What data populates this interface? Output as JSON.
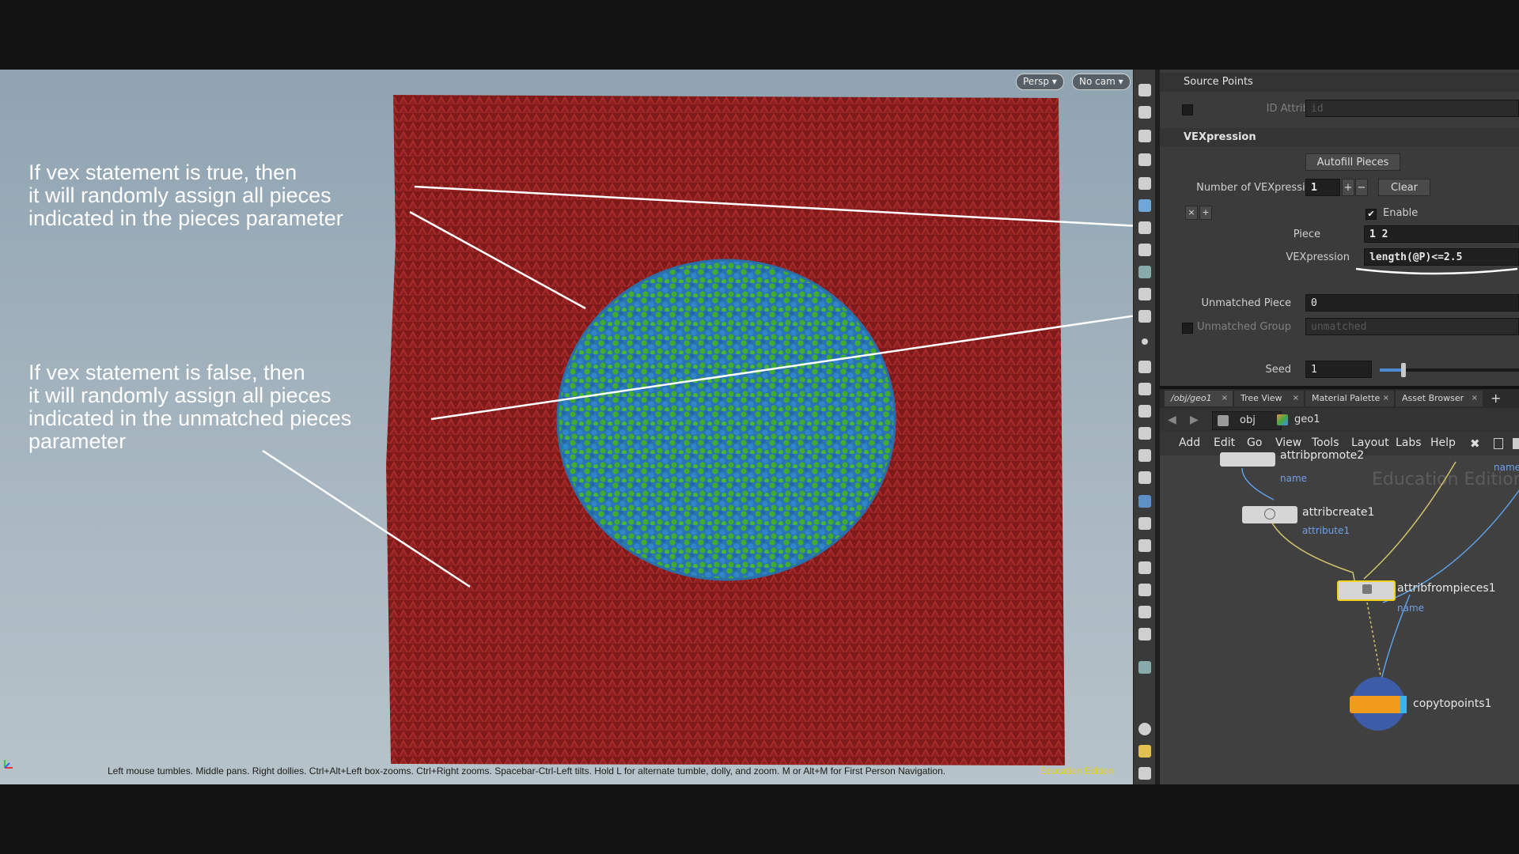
{
  "viewport": {
    "persp_label": "Persp ▾",
    "cam_label": "No cam ▾",
    "annotation_true": [
      "If vex statement is true, then",
      "it will randomly assign all pieces",
      "indicated in the pieces parameter"
    ],
    "annotation_false": [
      "If vex statement is false, then",
      "it will randomly assign all pieces",
      "indicated in the unmatched pieces",
      "parameter"
    ],
    "status_hint": "Left mouse tumbles. Middle pans. Right dollies. Ctrl+Alt+Left box-zooms. Ctrl+Right zooms. Spacebar-Ctrl-Left tilts. Hold L for alternate tumble, dolly, and zoom.     M or Alt+M for First Person Navigation.",
    "edu_label": "Education Edition",
    "colors": {
      "ground": "#8b1f1f",
      "sphere_blue": "#2a78b8",
      "sphere_green": "#3aa82a"
    }
  },
  "params": {
    "source_points_header": "Source Points",
    "id_attribute_label": "ID Attribute",
    "id_attribute_value": "id",
    "vexpression_header": "VEXpression",
    "autofill_label": "Autofill Pieces",
    "num_vex_label": "Number of VEXpressi...",
    "num_vex_value": "1",
    "plus_label": "+",
    "minus_label": "−",
    "clear_label": "Clear",
    "enable_label": "Enable",
    "piece_label": "Piece",
    "piece_value": "1 2",
    "vexpression_label": "VEXpression",
    "vexpression_value": "length(@P)<=2.5",
    "unmatched_piece_label": "Unmatched Piece",
    "unmatched_piece_value": "0",
    "unmatched_group_label": "Unmatched Group",
    "unmatched_group_value": "unmatched",
    "seed_label": "Seed",
    "seed_value": "1",
    "seed_slider_fraction": 0.17
  },
  "network": {
    "tabs": [
      {
        "label": "/obj/geo1"
      },
      {
        "label": "Tree View"
      },
      {
        "label": "Material Palette"
      },
      {
        "label": "Asset Browser"
      }
    ],
    "add_tab": "+",
    "path": {
      "root": "obj",
      "current": "geo1"
    },
    "menu": [
      "Add",
      "Edit",
      "Go",
      "View",
      "Tools",
      "Layout",
      "Labs",
      "Help"
    ],
    "edu_watermark": "Education Edition",
    "nodes": [
      {
        "name": "attribpromote2",
        "sub": "name"
      },
      {
        "name": "attribcreate1",
        "sub": "attribute1"
      },
      {
        "name": "attribfrompieces1",
        "sub": "name"
      },
      {
        "name": "copytopoints1",
        "sub": ""
      }
    ],
    "offscreen_sub": "name"
  }
}
